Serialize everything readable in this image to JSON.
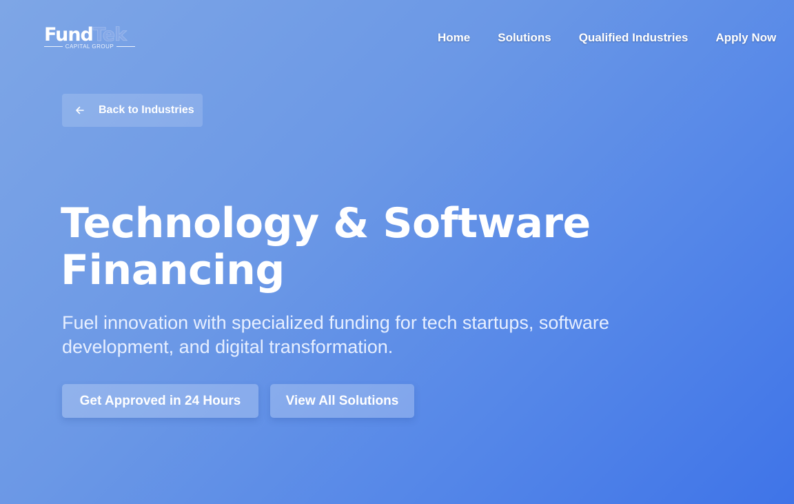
{
  "brand": {
    "name_part1": "Fund",
    "name_part2": "Tek",
    "tagline": "CAPITAL GROUP"
  },
  "nav": {
    "items": [
      {
        "label": "Home"
      },
      {
        "label": "Solutions"
      },
      {
        "label": "Qualified Industries"
      },
      {
        "label": "Apply Now"
      }
    ]
  },
  "back_button": {
    "label": "Back to Industries",
    "icon": "arrow-left-icon"
  },
  "hero": {
    "title_line1": "Technology & Software",
    "title_line2": "Financing",
    "subtitle": "Fuel innovation with specialized funding for tech startups, software development, and digital transformation."
  },
  "cta": {
    "primary_label": "Get Approved in 24 Hours",
    "secondary_label": "View All Solutions"
  },
  "colors": {
    "background_start": "#7ea6e6",
    "background_end": "#3f74e8",
    "text": "#ffffff"
  }
}
